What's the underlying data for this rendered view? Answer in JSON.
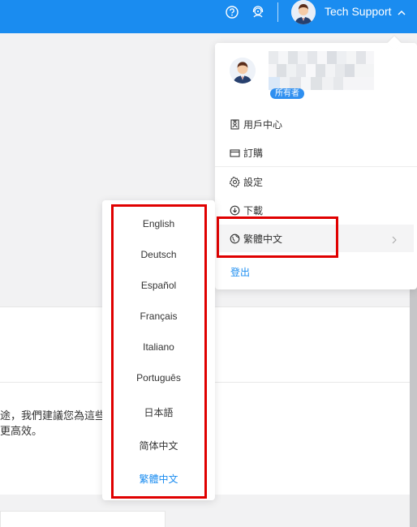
{
  "topbar": {
    "user_name": "Tech Support",
    "icons": [
      "help-circle-icon",
      "support-agent-icon",
      "chevron-up-icon"
    ]
  },
  "user_menu": {
    "role_badge": "所有者",
    "items": [
      {
        "label": "用戶中心",
        "icon": "id-card-icon"
      },
      {
        "label": "訂購",
        "icon": "card-icon"
      },
      {
        "label": "設定",
        "icon": "gear-icon"
      },
      {
        "label": "下載",
        "icon": "download-icon"
      },
      {
        "label": "繁體中文",
        "icon": "globe-icon"
      }
    ],
    "logout": "登出"
  },
  "language_menu": {
    "options": [
      "English",
      "Deutsch",
      "Español",
      "Français",
      "Italiano",
      "Português",
      "日本語",
      "简体中文",
      "繁體中文"
    ],
    "selected": "繁體中文"
  },
  "background": {
    "line1": "途，我們建議您為這些",
    "line2": "更高效。"
  },
  "colors": {
    "accent": "#1a8cf0",
    "highlight": "#e00000"
  }
}
